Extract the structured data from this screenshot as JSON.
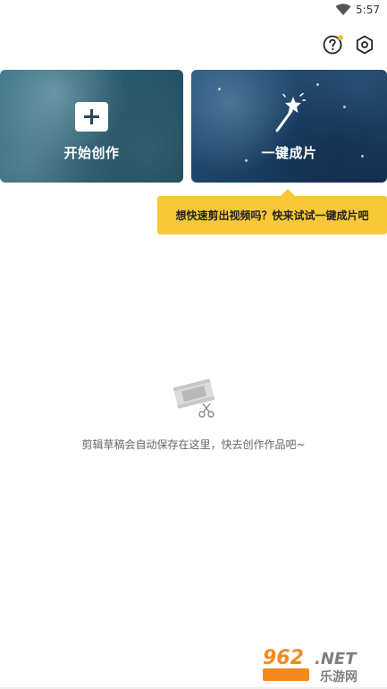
{
  "status_bar": {
    "time": "5:57",
    "wifi_icon": "wifi-icon"
  },
  "toolbar": {
    "help_icon": "help-icon",
    "settings_icon": "settings-icon",
    "notification_dot_color": "#f5c42c"
  },
  "cards": {
    "create": {
      "label": "开始创作",
      "icon": "plus-icon"
    },
    "quick": {
      "label": "一键成片",
      "icon": "magic-wand-icon"
    }
  },
  "tooltip": {
    "text": "想快速剪出视频吗？快来试试一键成片吧",
    "color": "#f7c938"
  },
  "empty_state": {
    "icon": "film-scissors-icon",
    "text": "剪辑草稿会自动保存在这里，快去创作作品吧~"
  },
  "watermark": {
    "text": "962.NET",
    "subtext": "乐游网"
  }
}
